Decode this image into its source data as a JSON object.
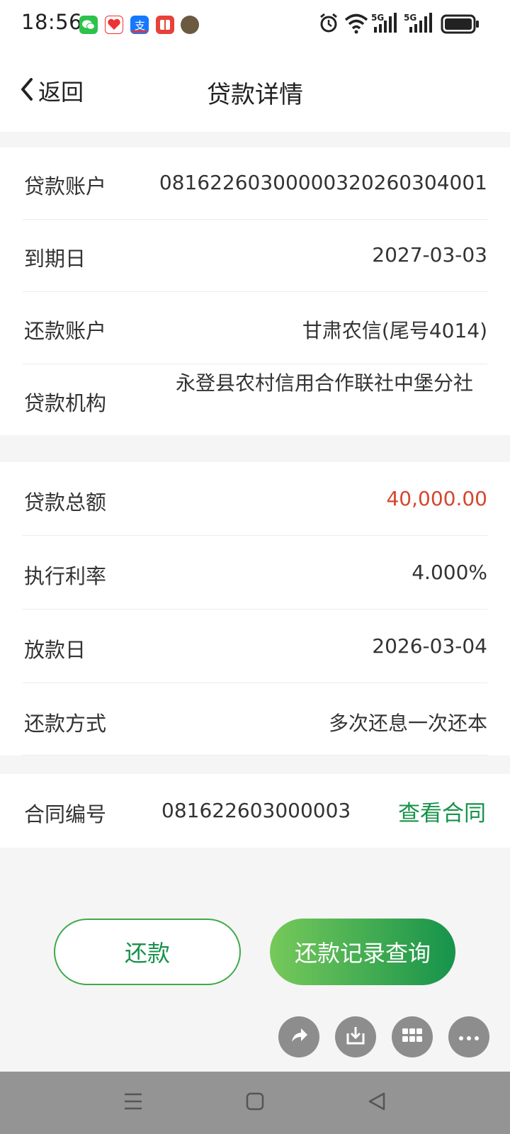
{
  "status_bar": {
    "time": "18:56",
    "network_1": "5G",
    "network_2": "5G"
  },
  "nav": {
    "back_label": "返回",
    "title": "贷款详情"
  },
  "account_info": {
    "loan_account_label": "贷款账户",
    "loan_account_value": "081622603000003202603040​01",
    "due_date_label": "到期日",
    "due_date_value": "2027-03-03",
    "repay_account_label": "还款账户",
    "repay_account_value": "甘肃农信(尾号4014)",
    "institution_label": "贷款机构",
    "institution_value": "永登县农村信用合作联社中堡分社"
  },
  "loan_info": {
    "total_label": "贷款总额",
    "total_value": "40,000.00",
    "rate_label": "执行利率",
    "rate_value": "4.000%",
    "disburse_label": "放款日",
    "disburse_value": "2026-03-04",
    "method_label": "还款方式",
    "method_value": "多次还息一次还本"
  },
  "contract": {
    "label": "合同编号",
    "number": "081622603000003",
    "view_link": "查看合同"
  },
  "actions": {
    "repay_label": "还款",
    "records_label": "还款记录查询"
  },
  "colors": {
    "accent_green": "#17924a",
    "amount_red": "#d5472d"
  },
  "icons": {
    "share": "share-icon",
    "download": "download-icon",
    "apps": "grid-icon",
    "more": "more-icon"
  }
}
